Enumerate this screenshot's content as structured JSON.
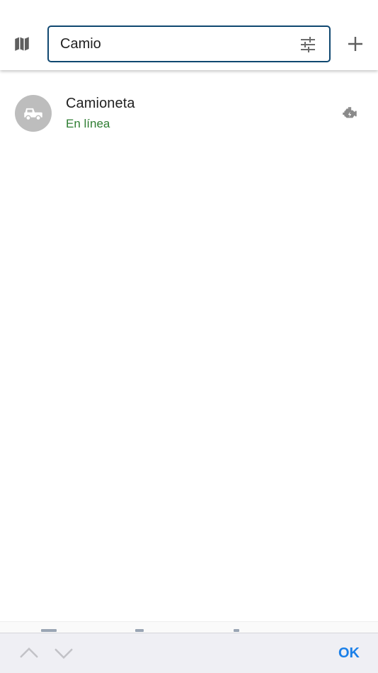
{
  "search": {
    "value": "Camio",
    "placeholder": ""
  },
  "icons": {
    "map": "map-icon",
    "filter": "tune-sliders-icon",
    "add": "plus-icon",
    "avatar": "truck-icon",
    "engine": "engine-icon",
    "chevron_up": "chevron-up-icon",
    "chevron_down": "chevron-down-icon"
  },
  "devices": [
    {
      "name": "Camioneta",
      "status": "En línea"
    }
  ],
  "keyboard_bar": {
    "done_label": "OK"
  },
  "colors": {
    "search_border": "#0f4770",
    "status_online": "#2e7d32",
    "avatar_bg": "#bdbdbd",
    "accent": "#1a7fe8"
  }
}
